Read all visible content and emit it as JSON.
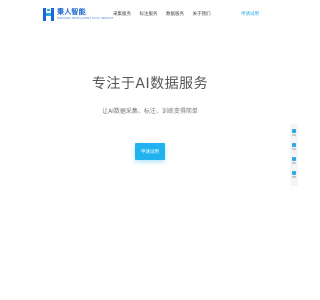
{
  "brand": {
    "name": "秉人智能",
    "tagline": "BINGREN INTELLIGENT DATA SERVICE",
    "color": "#1a66d2"
  },
  "nav": {
    "items": [
      {
        "label": "采集服务"
      },
      {
        "label": "标注服务"
      },
      {
        "label": "数据服务"
      },
      {
        "label": "关于我们"
      }
    ],
    "cta_label": "申请试用"
  },
  "hero": {
    "title": "专注于AI数据服务",
    "subtitle": "让AI数据采集、标注、训练变得简单",
    "button_label": "申请试用"
  },
  "side_toolbar": {
    "items": [
      {
        "label": "咨询",
        "icon": "chat-icon"
      },
      {
        "label": "电话",
        "icon": "phone-icon"
      },
      {
        "label": "微信",
        "icon": "qr-icon"
      },
      {
        "label": "顶部",
        "icon": "arrow-up-icon"
      }
    ]
  },
  "colors": {
    "accent": "#20b3ef",
    "link": "#2aa8e8",
    "text": "#555555"
  }
}
